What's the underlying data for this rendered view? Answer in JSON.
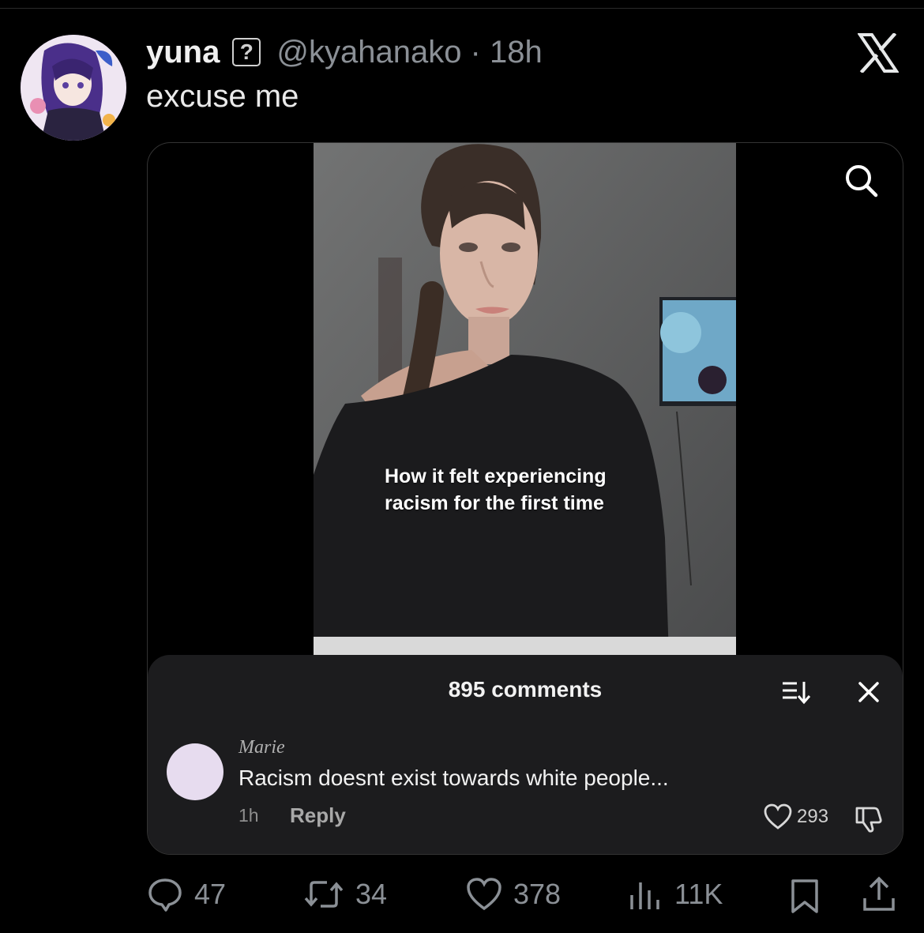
{
  "tweet": {
    "display_name": "yuna",
    "badge": "?",
    "handle_time": "@kyahanako · 18h",
    "text": "excuse me"
  },
  "media": {
    "caption": "How it felt experiencing racism for the first time"
  },
  "comments_sheet": {
    "title": "895 comments",
    "comment": {
      "username": "Marie",
      "text": "Racism doesnt exist towards white people...",
      "time": "1h",
      "reply_label": "Reply",
      "likes": "293"
    }
  },
  "stats": {
    "replies": "47",
    "reposts": "34",
    "likes": "378",
    "views": "11K"
  },
  "icons": {
    "app_logo": "x-logo-icon",
    "search": "search-icon",
    "sort": "sort-icon",
    "close": "close-icon",
    "heart": "heart-icon",
    "dislike": "thumbs-down-icon",
    "reply": "reply-icon",
    "repost": "repost-icon",
    "views": "views-icon",
    "bookmark": "bookmark-icon",
    "share": "share-icon"
  }
}
